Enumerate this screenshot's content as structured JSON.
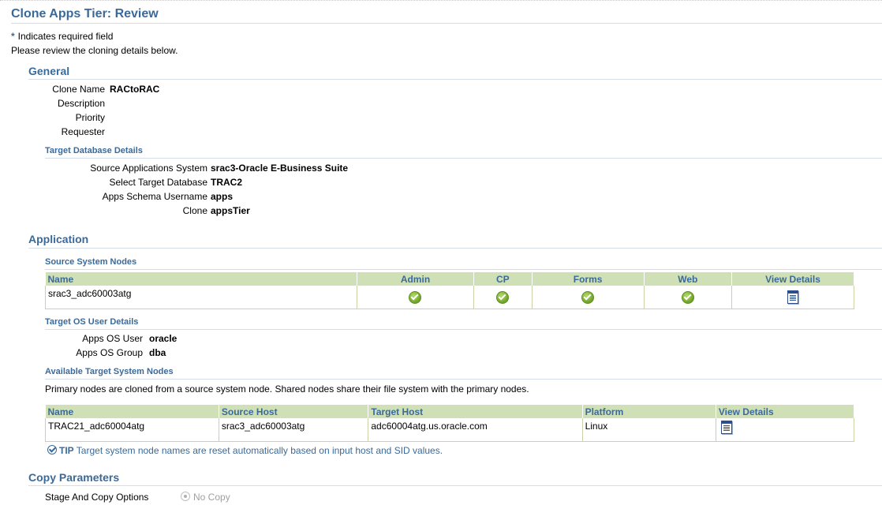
{
  "page": {
    "title": "Clone Apps Tier: Review",
    "required_note": "Indicates required field",
    "required_marker": "*",
    "intro": "Please review the cloning details below."
  },
  "general": {
    "heading": "General",
    "fields": [
      {
        "label": "Clone Name",
        "value": "RACtoRAC"
      },
      {
        "label": "Description",
        "value": ""
      },
      {
        "label": "Priority",
        "value": ""
      },
      {
        "label": "Requester",
        "value": ""
      }
    ],
    "target_db": {
      "heading": "Target Database Details",
      "fields": [
        {
          "label": "Source Applications System",
          "value": "srac3-Oracle E-Business Suite"
        },
        {
          "label": "Select Target Database",
          "value": "TRAC2"
        },
        {
          "label": "Apps Schema Username",
          "value": "apps"
        },
        {
          "label": "Clone",
          "value": "appsTier"
        }
      ]
    }
  },
  "application": {
    "heading": "Application",
    "source_nodes": {
      "heading": "Source System Nodes",
      "columns": [
        "Name",
        "Admin",
        "CP",
        "Forms",
        "Web",
        "View Details"
      ],
      "rows": [
        {
          "name": "srac3_adc60003atg",
          "admin": "check-icon",
          "cp": "check-icon",
          "forms": "check-icon",
          "web": "check-icon",
          "details": "view-details-icon"
        }
      ]
    },
    "os_user": {
      "heading": "Target OS User Details",
      "fields": [
        {
          "label": "Apps OS User",
          "value": "oracle"
        },
        {
          "label": "Apps OS Group",
          "value": "dba"
        }
      ]
    },
    "target_nodes": {
      "heading": "Available Target System Nodes",
      "description": "Primary nodes are cloned from a source system node. Shared nodes share their file system with the primary nodes.",
      "columns": [
        "Name",
        "Source Host",
        "Target Host",
        "Platform",
        "View Details"
      ],
      "rows": [
        {
          "name": "TRAC21_adc60004atg",
          "source_host": "srac3_adc60003atg",
          "target_host": "adc60004atg.us.oracle.com",
          "platform": "Linux",
          "details": "view-details-icon"
        }
      ],
      "tip_label": "TIP",
      "tip_text": "Target system node names are reset automatically based on input host and SID values."
    }
  },
  "copy": {
    "heading": "Copy Parameters",
    "stage_label": "Stage And Copy Options",
    "stage_option": "No Copy"
  },
  "colors": {
    "heading": "#3a6a9a",
    "table_header_bg": "#cfe0b6",
    "check_green": "#6fa12a"
  }
}
